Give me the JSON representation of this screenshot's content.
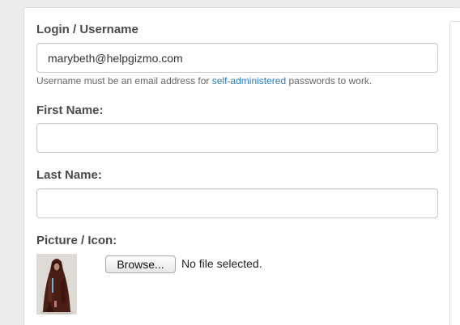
{
  "form": {
    "login": {
      "label": "Login / Username",
      "value": "marybeth@helpgizmo.com",
      "help_before": "Username must be an email address for ",
      "help_link": "self-administered",
      "help_after": " passwords to work."
    },
    "first_name": {
      "label": "First Name:",
      "value": ""
    },
    "last_name": {
      "label": "Last Name:",
      "value": ""
    },
    "picture": {
      "label": "Picture / Icon:",
      "browse_label": "Browse...",
      "file_status": "No file selected."
    }
  },
  "colors": {
    "link": "#2a7bbd",
    "label": "#4a4a4a"
  }
}
